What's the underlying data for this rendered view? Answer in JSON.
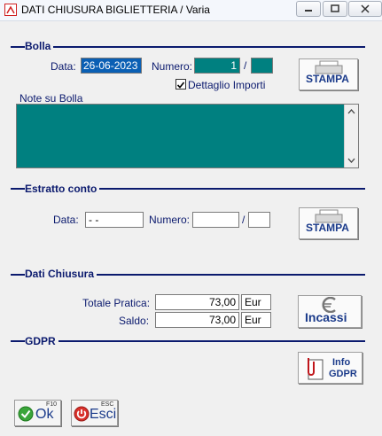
{
  "window": {
    "title": "DATI CHIUSURA BIGLIETTERIA / Varia"
  },
  "bolla": {
    "section_label": "Bolla",
    "date_label": "Data:",
    "date_value": "26-06-2023",
    "number_label": "Numero:",
    "number_value": "1",
    "separator": "/",
    "number_suffix": "",
    "checkbox_label": "Dettaglio Importi",
    "checkbox_checked": true,
    "print_label": "STAMPA",
    "notes_label": "Note su Bolla",
    "notes_value": ""
  },
  "estratto": {
    "section_label": "Estratto conto",
    "date_label": "Data:",
    "date_value": "- -",
    "number_label": "Numero:",
    "number_value": "",
    "separator": "/",
    "number_suffix": "",
    "print_label": "STAMPA"
  },
  "dati_chiusura": {
    "section_label": "Dati Chiusura",
    "totale_label": "Totale Pratica:",
    "totale_value": "73,00",
    "totale_currency": "Eur",
    "saldo_label": "Saldo:",
    "saldo_value": "73,00",
    "saldo_currency": "Eur",
    "incassi_label": "Incassi"
  },
  "gdpr": {
    "section_label": "GDPR",
    "info_line1": "Info",
    "info_line2": "GDPR"
  },
  "footer": {
    "ok_label": "Ok",
    "ok_key": "F10",
    "esci_label": "Esci",
    "esci_key": "ESC"
  }
}
